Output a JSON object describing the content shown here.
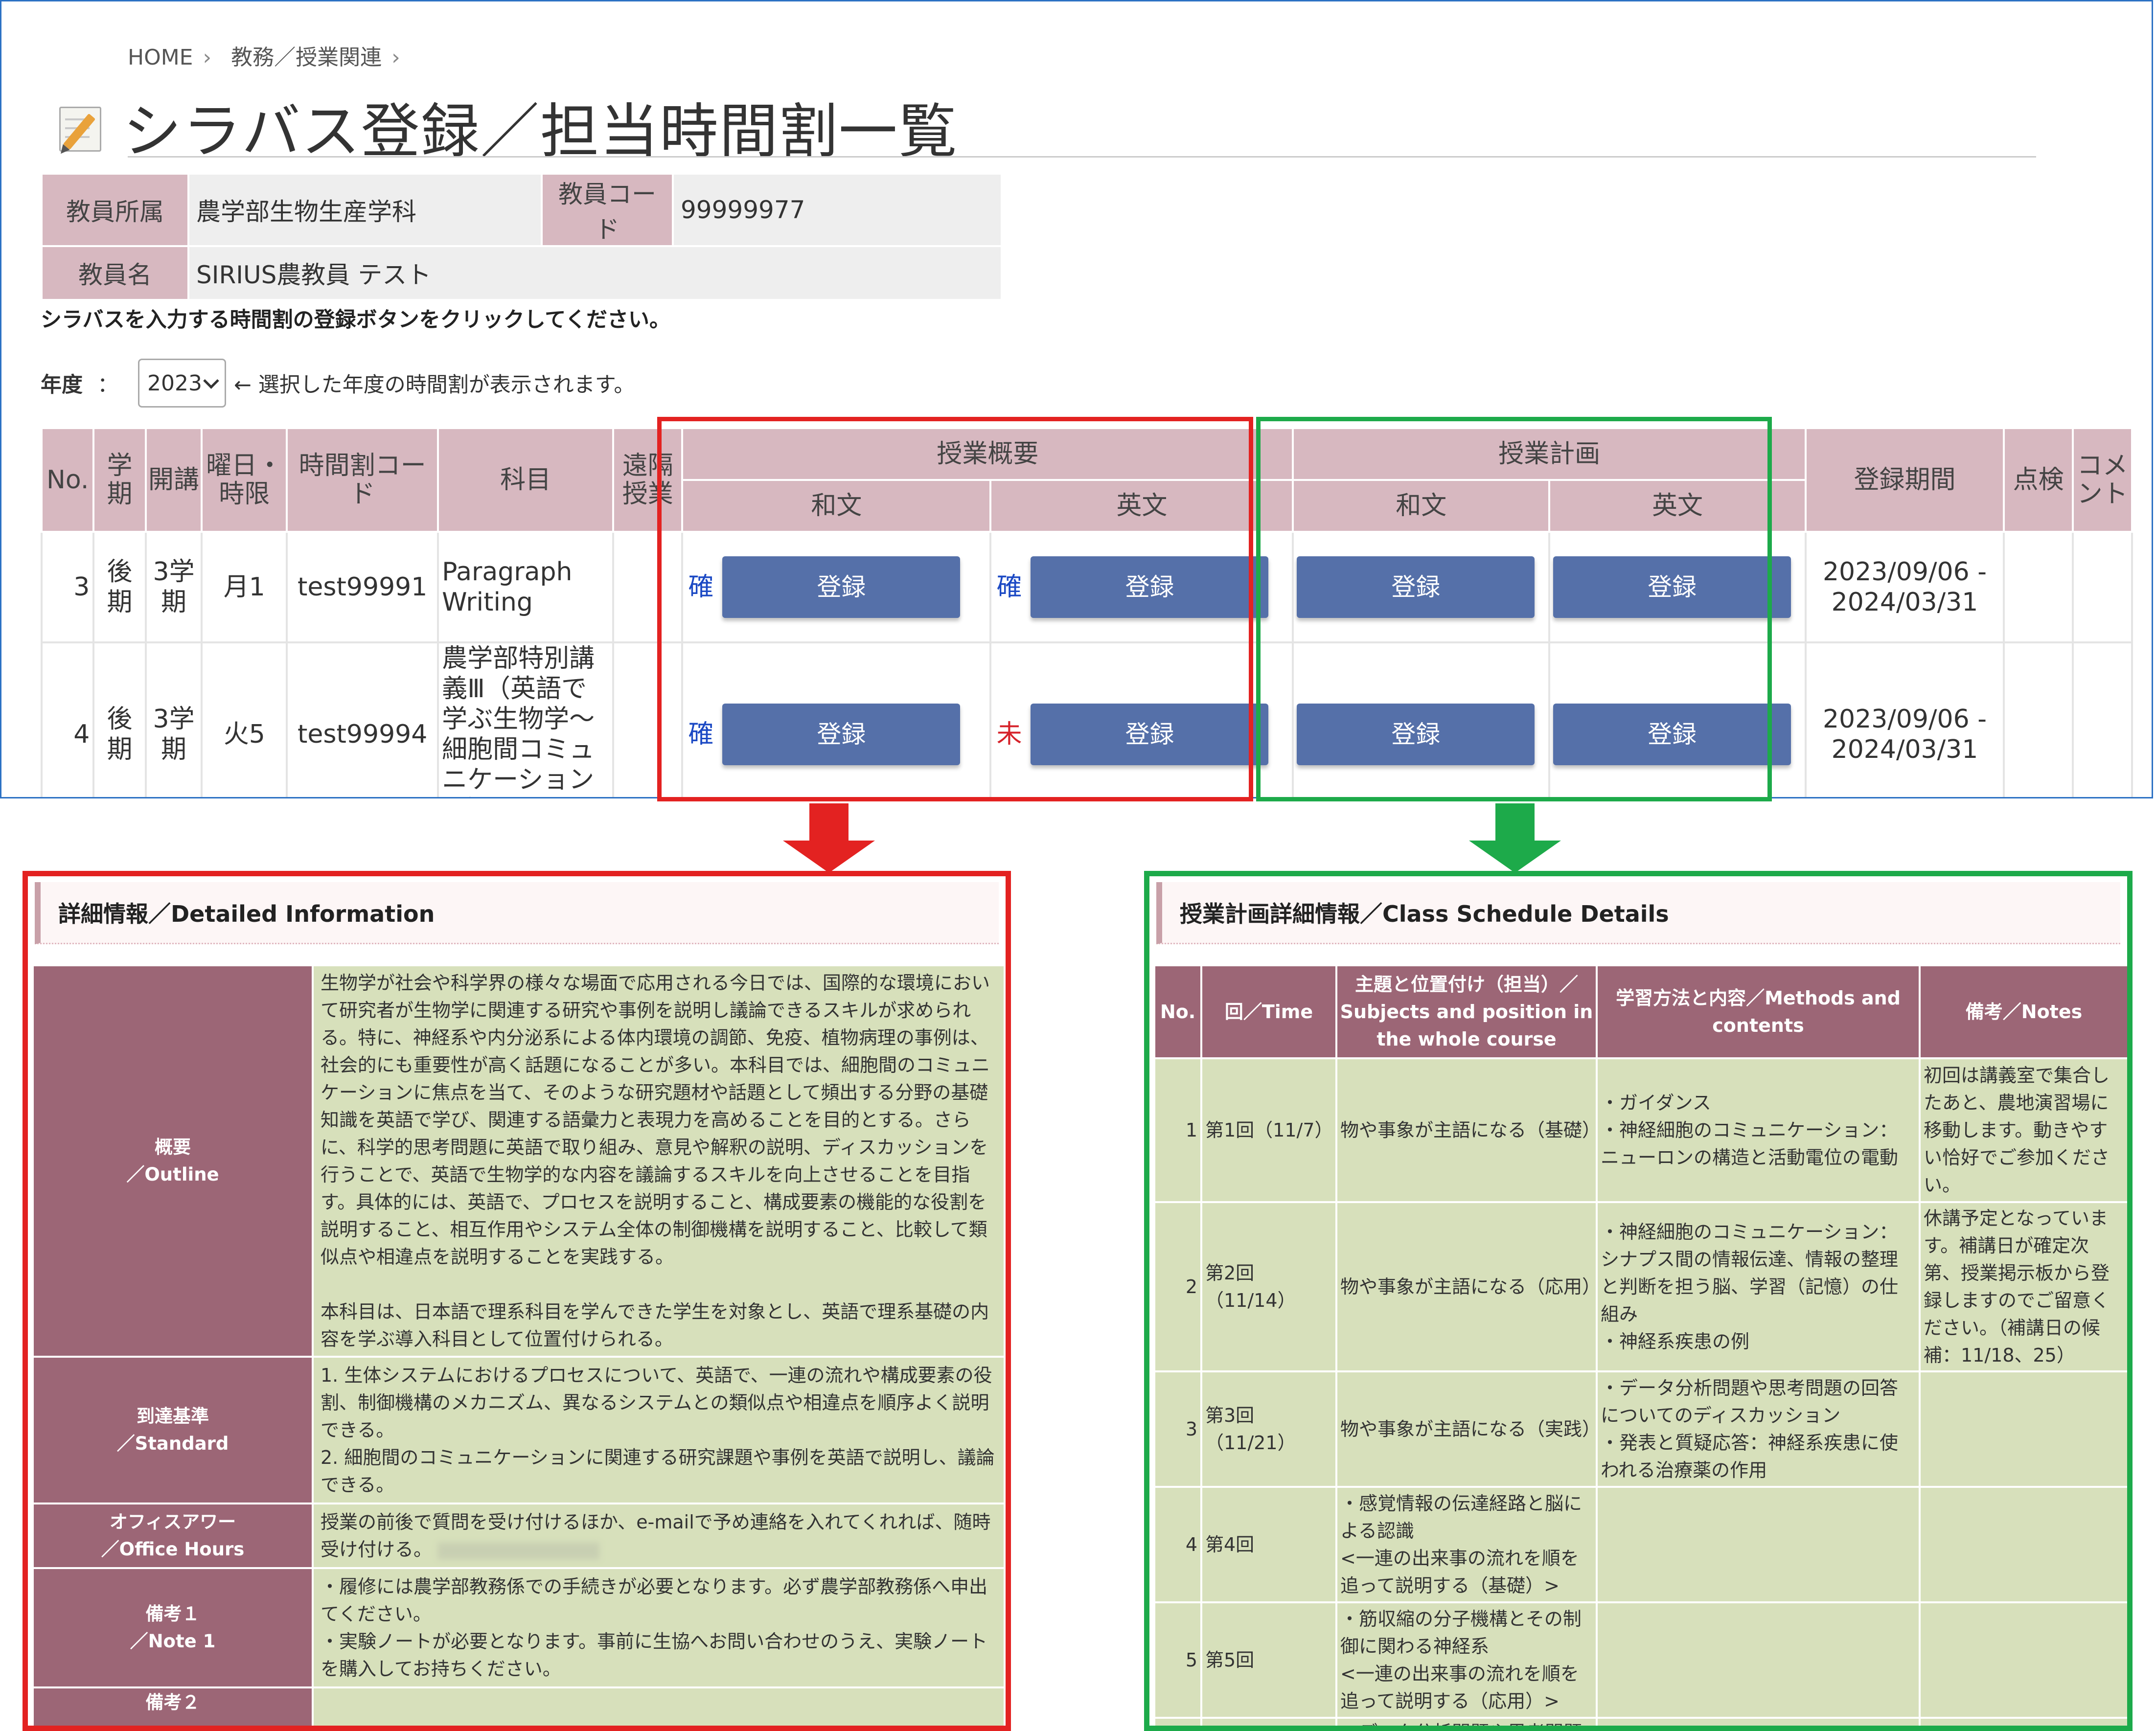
{
  "breadcrumb": {
    "home": "HOME",
    "sep1": "›",
    "section": "教務／授業関連",
    "sep2": "›"
  },
  "page_title": "シラバス登録／担当時間割一覧",
  "info": {
    "affiliation_label": "教員所属",
    "affiliation_value": "農学部生物生産学科",
    "code_label": "教員コード",
    "code_value": "99999977",
    "name_label": "教員名",
    "name_value": "SIRIUS農教員 テスト"
  },
  "instruction": "シラバスを入力する時間割の登録ボタンをクリックしてください。",
  "year": {
    "label": "年度",
    "colon": "：",
    "selected": "2023",
    "hint": "← 選択した年度の時間割が表示されます。"
  },
  "table": {
    "headers": {
      "no": "No.",
      "term": "学期",
      "open": "開講",
      "day": "曜日・時限",
      "code": "時間割コード",
      "subject": "科目",
      "remote": "遠隔授業",
      "overview": "授業概要",
      "plan": "授業計画",
      "ja": "和文",
      "en": "英文",
      "period": "登録期間",
      "check": "点検",
      "comment": "コメント"
    },
    "register_label": "登録",
    "rows": [
      {
        "no": "3",
        "term": "後期",
        "open": "3学期",
        "day": "月1",
        "code": "test99991",
        "subject": "Paragraph Writing",
        "ov_ja_flag": "確",
        "ov_en_flag": "確",
        "period": "2023/09/06 - 2024/03/31"
      },
      {
        "no": "4",
        "term": "後期",
        "open": "3学期",
        "day": "火5",
        "code": "test99994",
        "subject": "農学部特別講義Ⅲ（英語で学ぶ生物学～細胞間コミュニケーション～）",
        "ov_ja_flag": "確",
        "ov_en_flag": "未",
        "period": "2023/09/06 - 2024/03/31"
      }
    ]
  },
  "detail": {
    "heading": "詳細情報／Detailed Information",
    "rows": [
      {
        "label_ja": "概要",
        "label_en": "／Outline",
        "p1": "生物学が社会や科学界の様々な場面で応用される今日では、国際的な環境において研究者が生物学に関連する研究や事例を説明し議論できるスキルが求められる。特に、神経系や内分泌系による体内環境の調節、免疫、植物病理の事例は、社会的にも重要性が高く話題になることが多い。本科目では、細胞間のコミュニケーションに焦点を当て、そのような研究題材や話題として頻出する分野の基礎知識を英語で学び、関連する語彙力と表現力を高めることを目的とする。さらに、科学的思考問題に英語で取り組み、意見や解釈の説明、ディスカッションを行うことで、英語で生物学的な内容を議論するスキルを向上させることを目指す。具体的には、英語で、プロセスを説明すること、構成要素の機能的な役割を説明すること、相互作用やシステム全体の制御機構を説明すること、比較して類似点や相違点を説明することを実践する。",
        "p2": "本科目は、日本語で理系科目を学んできた学生を対象とし、英語で理系基礎の内容を学ぶ導入科目として位置付けられる。"
      },
      {
        "label_ja": "到達基準",
        "label_en": "／Standard",
        "p1": "1. 生体システムにおけるプロセスについて、英語で、一連の流れや構成要素の役割、制御機構のメカニズム、異なるシステムとの類似点や相違点を順序よく説明できる。",
        "p2": "2. 細胞間のコミュニケーションに関連する研究課題や事例を英語で説明し、議論できる。"
      },
      {
        "label_ja": "オフィスアワー",
        "label_en": "／Office Hours",
        "p1": "授業の前後で質問を受け付けるほか、e-mailで予め連絡を入れてくれれば、随時受け付ける。"
      },
      {
        "label_ja": "備考１",
        "label_en": "／Note 1",
        "p1": "・履修には農学部教務係での手続きが必要となります。必ず農学部教務係へ申出てください。",
        "p2": "・実験ノートが必要となります。事前に生協へお問い合わせのうえ、実験ノートを購入してお持ちください。"
      },
      {
        "label_ja": "備考２",
        "label_en": ""
      }
    ]
  },
  "schedule": {
    "heading": "授業計画詳細情報／Class Schedule Details",
    "headers": {
      "no": "No.",
      "time": "回／Time",
      "subject": "主題と位置付け（担当）／Subjects and position in the whole course",
      "methods": "学習方法と内容／Methods and contents",
      "notes": "備考／Notes"
    },
    "rows": [
      {
        "no": "1",
        "time": "第1回（11/7）",
        "subject": "物や事象が主語になる（基礎）",
        "methods": "・ガイダンス\n・神経細胞のコミュニケーション：ニューロンの構造と活動電位の電動",
        "notes": "初回は講義室で集合したあと、農地演習場に移動します。動きやすい恰好でご参加ください。"
      },
      {
        "no": "2",
        "time": "第2回（11/14）",
        "subject": "物や事象が主語になる（応用）",
        "methods": "・神経細胞のコミュニケーション：シナプス間の情報伝達、情報の整理と判断を担う脳、学習（記憶）の仕組み\n・神経系疾患の例",
        "notes": "休講予定となっています。補講日が確定次第、授業掲示板から登録しますのでご留意ください。（補講日の候補：11/18、25）"
      },
      {
        "no": "3",
        "time": "第3回（11/21）",
        "subject": "物や事象が主語になる（実践）",
        "methods": "・データ分析問題や思考問題の回答についてのディスカッション\n・発表と質疑応答：神経系疾患に使われる治療薬の作用",
        "notes": ""
      },
      {
        "no": "4",
        "time": "第4回",
        "subject": "・感覚情報の伝達経路と脳による認識\n<一連の出来事の流れを順を追って説明する（基礎）>",
        "methods": "",
        "notes": ""
      },
      {
        "no": "5",
        "time": "第5回",
        "subject": "・筋収縮の分子機構とその制御に関わる神経系\n<一連の出来事の流れを順を追って説明する（応用）>",
        "methods": "",
        "notes": ""
      },
      {
        "no": "",
        "time": "",
        "subject": "・データ分析問題や思考問題の",
        "methods": "",
        "notes": ""
      }
    ]
  },
  "colors": {
    "accent_red": "#e32221",
    "accent_green": "#1daa4a",
    "header_pink": "#d7b8c0",
    "button_blue": "#5570a9",
    "label_mauve": "#9c6676",
    "cell_green": "#d7e0bb"
  },
  "icons": {
    "title_icon": "memo-pencil-icon",
    "select_icon": "chevron-down-icon",
    "arrow_icon": "arrow-down-icon"
  }
}
